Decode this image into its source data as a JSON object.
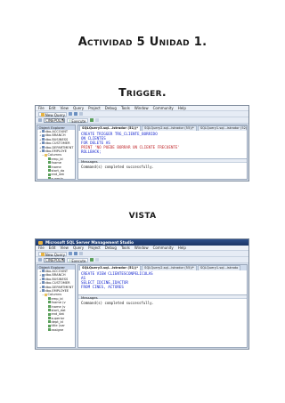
{
  "headings": {
    "activity": "Actividad 5 Unidad 1.",
    "trigger": "Trigger.",
    "view": "vista"
  },
  "screenshot_trigger": {
    "menu": [
      "File",
      "Edit",
      "View",
      "Query",
      "Project",
      "Debug",
      "Tools",
      "Window",
      "Community",
      "Help"
    ],
    "toolbar": {
      "new_query": "New Query",
      "database": "CINEPOLIS",
      "execute": "Execute"
    },
    "explorer_title": "Object Explorer",
    "explorer_items": [
      {
        "kind": "table",
        "label": "dbo.ACCOUNT"
      },
      {
        "kind": "table",
        "label": "dbo.BRANCH"
      },
      {
        "kind": "table",
        "label": "dbo.BUSINESS"
      },
      {
        "kind": "table",
        "label": "dbo.CUSTOMER"
      },
      {
        "kind": "table",
        "label": "dbo.DEPARTMENT"
      },
      {
        "kind": "table",
        "label": "dbo.EMPLOYE"
      },
      {
        "kind": "folder",
        "label": "Columns"
      },
      {
        "kind": "col",
        "label": "emp_id"
      },
      {
        "kind": "col",
        "label": "fname"
      },
      {
        "kind": "col",
        "label": "lname"
      },
      {
        "kind": "col",
        "label": "start_da"
      },
      {
        "kind": "col",
        "label": "end_dat"
      },
      {
        "kind": "col",
        "label": "superio"
      },
      {
        "kind": "col",
        "label": "dept_id"
      }
    ],
    "tabs": [
      "SQLQuery3.sql...istrador (51))*",
      "SQLQuery2.sql...istrador (55))*",
      "SQLQuery1.sql...istrador (52))*"
    ],
    "code": [
      "CREATE TRIGGER TRG_CLIENTE_BORRIDO",
      "ON CLIENTES",
      "FOR DELETE AS",
      "PRINT 'NO PUEDE BORRAR UN CLIENTE FRECUENTE'",
      "ROLLBACK;"
    ],
    "messages_tab": "Messages",
    "message": "Command(s) completed successfully."
  },
  "screenshot_view": {
    "app_title": "Microsoft SQL Server Management Studio",
    "menu": [
      "File",
      "Edit",
      "View",
      "Query",
      "Project",
      "Debug",
      "Tools",
      "Window",
      "Community",
      "Help"
    ],
    "toolbar": {
      "new_query": "New Query",
      "database": "CINEPOLIS",
      "execute": "Execute"
    },
    "explorer_title": "Object Explorer",
    "explorer_items": [
      {
        "kind": "table",
        "label": "dbo.ACCOUNT"
      },
      {
        "kind": "table",
        "label": "dbo.BRANCH"
      },
      {
        "kind": "table",
        "label": "dbo.BUSINESS"
      },
      {
        "kind": "table",
        "label": "dbo.CUSTOMER"
      },
      {
        "kind": "table",
        "label": "dbo.DEPARTMENT"
      },
      {
        "kind": "table",
        "label": "dbo.EMPLOYEE"
      },
      {
        "kind": "folder",
        "label": "Columns"
      },
      {
        "kind": "col",
        "label": "emp_id"
      },
      {
        "kind": "col",
        "label": "fname (v"
      },
      {
        "kind": "col",
        "label": "lname (v"
      },
      {
        "kind": "col",
        "label": "start_dat"
      },
      {
        "kind": "col",
        "label": "end_dat"
      },
      {
        "kind": "col",
        "label": "superior"
      },
      {
        "kind": "col",
        "label": "dept_id"
      },
      {
        "kind": "col",
        "label": "title (var"
      },
      {
        "kind": "col",
        "label": "assigne"
      }
    ],
    "tabs": [
      "SQLQuery3.sql...istrador (51))*",
      "SQLQuery2.sql...istrador (55))*",
      "SQLQuery1.sql...istrado"
    ],
    "code": [
      "CREATE VIEW CLIENTESCONPELICULAS",
      "AS",
      "SELECT IDCINE,IDACTOR",
      "FROM CINES, ACTORES"
    ],
    "messages_tab": "Messages",
    "message": "Command(s) completed successfully."
  }
}
